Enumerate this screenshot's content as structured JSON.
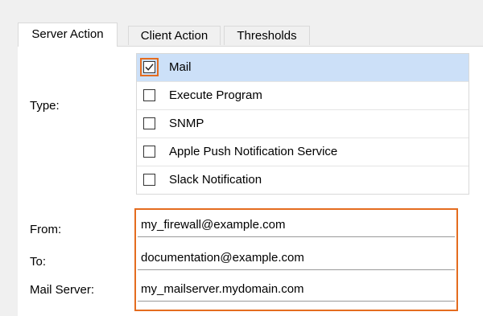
{
  "tabs": [
    "Server Action",
    "Client Action",
    "Thresholds"
  ],
  "type_label": "Type:",
  "type_options": [
    {
      "label": "Mail",
      "checked": true
    },
    {
      "label": "Execute Program",
      "checked": false
    },
    {
      "label": "SNMP",
      "checked": false
    },
    {
      "label": "Apple Push Notification Service",
      "checked": false
    },
    {
      "label": "Slack Notification",
      "checked": false
    }
  ],
  "fields": {
    "from": {
      "label": "From:",
      "value": "my_firewall@example.com"
    },
    "to": {
      "label": "To:",
      "value": "documentation@example.com"
    },
    "mail_server": {
      "label": "Mail Server:",
      "value": "my_mailserver.mydomain.com"
    }
  },
  "colors": {
    "highlight": "#e46c1f",
    "selected_row": "#cce0f8"
  }
}
